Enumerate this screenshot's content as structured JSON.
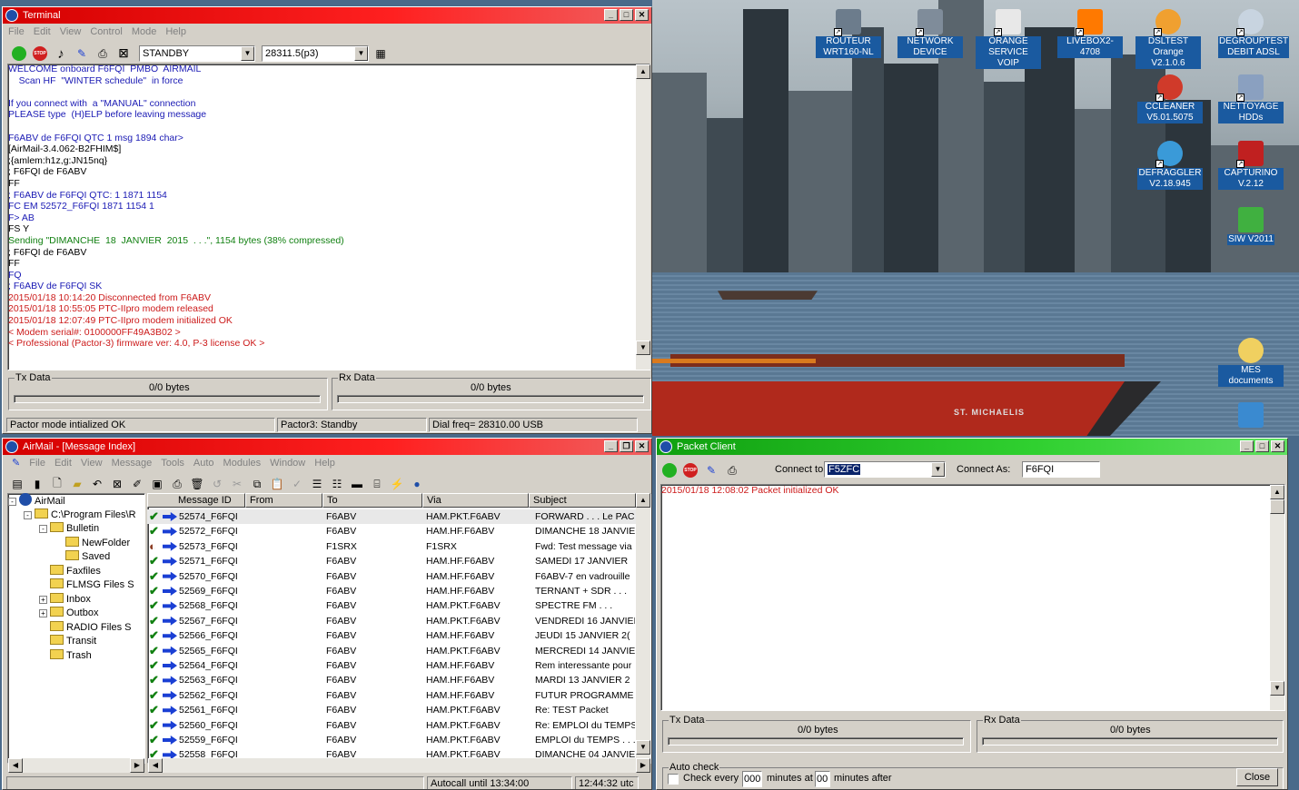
{
  "desktop": {
    "icons": [
      {
        "label": "ROUTEUR WRT160-NL",
        "icon": "router-icon",
        "color": "#6c7c8c"
      },
      {
        "label": "NETWORK DEVICE",
        "icon": "network-device-icon",
        "color": "#7f8c9a"
      },
      {
        "label": "ORANGE SERVICE VOIP",
        "icon": "document-icon",
        "color": "#e8e8e8"
      },
      {
        "label": "LIVEBOX2-4708",
        "icon": "orange-logo-icon",
        "color": "#ff7900"
      },
      {
        "label": "DSLTEST Orange V2.1.0.6",
        "icon": "dsltest-icon",
        "color": "#f0a030"
      },
      {
        "label": "DEGROUPTEST DEBIT ADSL",
        "icon": "stopwatch-icon",
        "color": "#c8d4e0"
      },
      {
        "label": "CCLEANER V5.01.5075",
        "icon": "ccleaner-icon",
        "color": "#d03a2a"
      },
      {
        "label": "NETTOYAGE HDDs",
        "icon": "cleanup-icon",
        "color": "#8aa0c0"
      },
      {
        "label": "DEFRAGGLER V2.18.945",
        "icon": "defraggler-icon",
        "color": "#3a9ad8"
      },
      {
        "label": "CAPTURINO V.2.12",
        "icon": "capturino-icon",
        "color": "#c02020"
      },
      {
        "label": "SIW V2011",
        "icon": "siw-icon",
        "color": "#40b040"
      },
      {
        "label": "MES documents",
        "icon": "my-documents-icon",
        "color": "#f0d060"
      },
      {
        "label": "",
        "icon": "computer-icon",
        "color": "#3a8ad0"
      }
    ],
    "ship_name": "ST. MICHAELIS"
  },
  "terminal": {
    "title": "Terminal",
    "title_color": "#d40000",
    "menu": [
      "File",
      "Edit",
      "View",
      "Control",
      "Mode",
      "Help"
    ],
    "mode_select": "STANDBY",
    "freq_select": "28311.5(p3)",
    "lines": [
      {
        "text": "WELCOME onboard F6FQI  PMBO  AIRMAIL",
        "color": "blue"
      },
      {
        "text": "    Scan HF  \"WINTER schedule\"  in force",
        "color": "blue"
      },
      {
        "text": "",
        "color": "blue"
      },
      {
        "text": "If you connect with  a \"MANUAL\" connection",
        "color": "blue"
      },
      {
        "text": "PLEASE type  (H)ELP before leaving message",
        "color": "blue"
      },
      {
        "text": "",
        "color": "blue"
      },
      {
        "text": "F6ABV de F6FQI QTC 1 msg 1894 char>",
        "color": "blue"
      },
      {
        "text": "[AirMail-3.4.062-B2FHIM$]",
        "color": "black"
      },
      {
        "text": ";{amlem:h1z,g:JN15nq}",
        "color": "black"
      },
      {
        "text": "; F6FQI de F6ABV",
        "color": "black"
      },
      {
        "text": "FF",
        "color": "black"
      },
      {
        "text": "; F6ABV de F6FQI QTC: 1 1871 1154",
        "color": "blue"
      },
      {
        "text": "FC EM 52572_F6FQI 1871 1154 1",
        "color": "blue"
      },
      {
        "text": "F> AB",
        "color": "blue"
      },
      {
        "text": "FS Y",
        "color": "black"
      },
      {
        "text": "Sending \"DIMANCHE  18  JANVIER  2015  . . .\", 1154 bytes (38% compressed)",
        "color": "green"
      },
      {
        "text": "; F6FQI de F6ABV",
        "color": "black"
      },
      {
        "text": "FF",
        "color": "black"
      },
      {
        "text": "FQ",
        "color": "blue"
      },
      {
        "text": "; F6ABV de F6FQI SK",
        "color": "blue"
      },
      {
        "text": "2015/01/18 10:14:20 Disconnected from F6ABV",
        "color": "red"
      },
      {
        "text": "2015/01/18 10:55:05 PTC-IIpro modem released",
        "color": "red"
      },
      {
        "text": "2015/01/18 12:07:49 PTC-IIpro modem initialized OK",
        "color": "red"
      },
      {
        "text": "< Modem serial#: 0100000FF49A3B02 >",
        "color": "red"
      },
      {
        "text": "< Professional (Pactor-3) firmware ver: 4.0, P-3 license OK >",
        "color": "red"
      }
    ],
    "tx": {
      "label": "Tx Data",
      "value": "0/0 bytes"
    },
    "rx": {
      "label": "Rx Data",
      "value": "0/0 bytes"
    },
    "status": [
      "Pactor mode intialized OK",
      "Pactor3: Standby",
      "Dial freq= 28310.00 USB"
    ]
  },
  "airmail": {
    "title": "AirMail - [Message Index]",
    "title_color": "#d40000",
    "menu": [
      "File",
      "Edit",
      "View",
      "Message",
      "Tools",
      "Auto",
      "Modules",
      "Window",
      "Help"
    ],
    "tree": [
      {
        "label": "AirMail",
        "indent": 0,
        "expander": "-",
        "kind": "globe"
      },
      {
        "label": "C:\\Program Files\\R",
        "indent": 1,
        "expander": "-",
        "kind": "folder"
      },
      {
        "label": "Bulletin",
        "indent": 2,
        "expander": "-",
        "kind": "folder"
      },
      {
        "label": "NewFolder",
        "indent": 3,
        "expander": "",
        "kind": "folder"
      },
      {
        "label": "Saved",
        "indent": 3,
        "expander": "",
        "kind": "folder"
      },
      {
        "label": "Faxfiles",
        "indent": 2,
        "expander": "",
        "kind": "folder"
      },
      {
        "label": "FLMSG Files  S",
        "indent": 2,
        "expander": "",
        "kind": "folder"
      },
      {
        "label": "Inbox",
        "indent": 2,
        "expander": "+",
        "kind": "folder"
      },
      {
        "label": "Outbox",
        "indent": 2,
        "expander": "+",
        "kind": "folder"
      },
      {
        "label": "RADIO Files  S",
        "indent": 2,
        "expander": "",
        "kind": "folder"
      },
      {
        "label": "Transit",
        "indent": 2,
        "expander": "",
        "kind": "folder"
      },
      {
        "label": "Trash",
        "indent": 2,
        "expander": "",
        "kind": "folder"
      }
    ],
    "columns": [
      "Message ID",
      "From",
      "To",
      "Via",
      "Subject"
    ],
    "rows": [
      {
        "id": "52574_F6FQI",
        "from": "",
        "to": "F6ABV",
        "via": "HAM.PKT.F6ABV",
        "subject": "FORWARD . . . Le PAC"
      },
      {
        "id": "52572_F6FQI",
        "from": "",
        "to": "F6ABV",
        "via": "HAM.HF.F6ABV",
        "subject": "DIMANCHE  18  JANVIE"
      },
      {
        "id": "52573_F6FQI",
        "from": "",
        "to": "F1SRX",
        "via": "F1SRX",
        "subject": "Fwd: Test message via"
      },
      {
        "id": "52571_F6FQI",
        "from": "",
        "to": "F6ABV",
        "via": "HAM.HF.F6ABV",
        "subject": "SAMEDI  17  JANVIER"
      },
      {
        "id": "52570_F6FQI",
        "from": "",
        "to": "F6ABV",
        "via": "HAM.HF.F6ABV",
        "subject": "F6ABV-7  en vadrouille"
      },
      {
        "id": "52569_F6FQI",
        "from": "",
        "to": "F6ABV",
        "via": "HAM.HF.F6ABV",
        "subject": "TERNANT + SDR   . . ."
      },
      {
        "id": "52568_F6FQI",
        "from": "",
        "to": "F6ABV",
        "via": "HAM.PKT.F6ABV",
        "subject": "SPECTRE FM  . . ."
      },
      {
        "id": "52567_F6FQI",
        "from": "",
        "to": "F6ABV",
        "via": "HAM.PKT.F6ABV",
        "subject": "VENDREDI  16  JANVIEI"
      },
      {
        "id": "52566_F6FQI",
        "from": "",
        "to": "F6ABV",
        "via": "HAM.HF.F6ABV",
        "subject": "JEUDI  15  JANVIER  2("
      },
      {
        "id": "52565_F6FQI",
        "from": "",
        "to": "F6ABV",
        "via": "HAM.PKT.F6ABV",
        "subject": "MERCREDI  14  JANVIE"
      },
      {
        "id": "52564_F6FQI",
        "from": "",
        "to": "F6ABV",
        "via": "HAM.HF.F6ABV",
        "subject": "Rem interessante pour"
      },
      {
        "id": "52563_F6FQI",
        "from": "",
        "to": "F6ABV",
        "via": "HAM.HF.F6ABV",
        "subject": "MARDI  13  JANVIER  2"
      },
      {
        "id": "52562_F6FQI",
        "from": "",
        "to": "F6ABV",
        "via": "HAM.HF.F6ABV",
        "subject": "FUTUR  PROGRAMME ."
      },
      {
        "id": "52561_F6FQI",
        "from": "",
        "to": "F6ABV",
        "via": "HAM.PKT.F6ABV",
        "subject": "Re: TEST Packet"
      },
      {
        "id": "52560_F6FQI",
        "from": "",
        "to": "F6ABV",
        "via": "HAM.PKT.F6ABV",
        "subject": "Re: EMPLOI du TEMPS"
      },
      {
        "id": "52559_F6FQI",
        "from": "",
        "to": "F6ABV",
        "via": "HAM.PKT.F6ABV",
        "subject": "EMPLOI du TEMPS  . . ."
      },
      {
        "id": "52558_F6FQI",
        "from": "",
        "to": "F6ABV",
        "via": "HAM.PKT.F6ABV",
        "subject": "DIMANCHE  04  JANVIE"
      }
    ],
    "status": [
      "",
      "Autocall until 13:34:00",
      "12:44:32 utc"
    ]
  },
  "packet": {
    "title": "Packet Client",
    "title_color": "#20c020",
    "connect_to_label": "Connect to:",
    "connect_to_value": "F5ZFC",
    "connect_as_label": "Connect As:",
    "connect_as_value": "F6FQI",
    "log": "2015/01/18 12:08:02 Packet initialized OK",
    "tx": {
      "label": "Tx Data",
      "value": "0/0 bytes"
    },
    "rx": {
      "label": "Rx Data",
      "value": "0/0 bytes"
    },
    "autocheck_label": "Auto check",
    "check_every_label": "Check every",
    "check_every_value": "000",
    "minutes_at_label": "minutes at",
    "minutes_at_value": "00",
    "minutes_after_label": "minutes after",
    "close_label": "Close"
  }
}
